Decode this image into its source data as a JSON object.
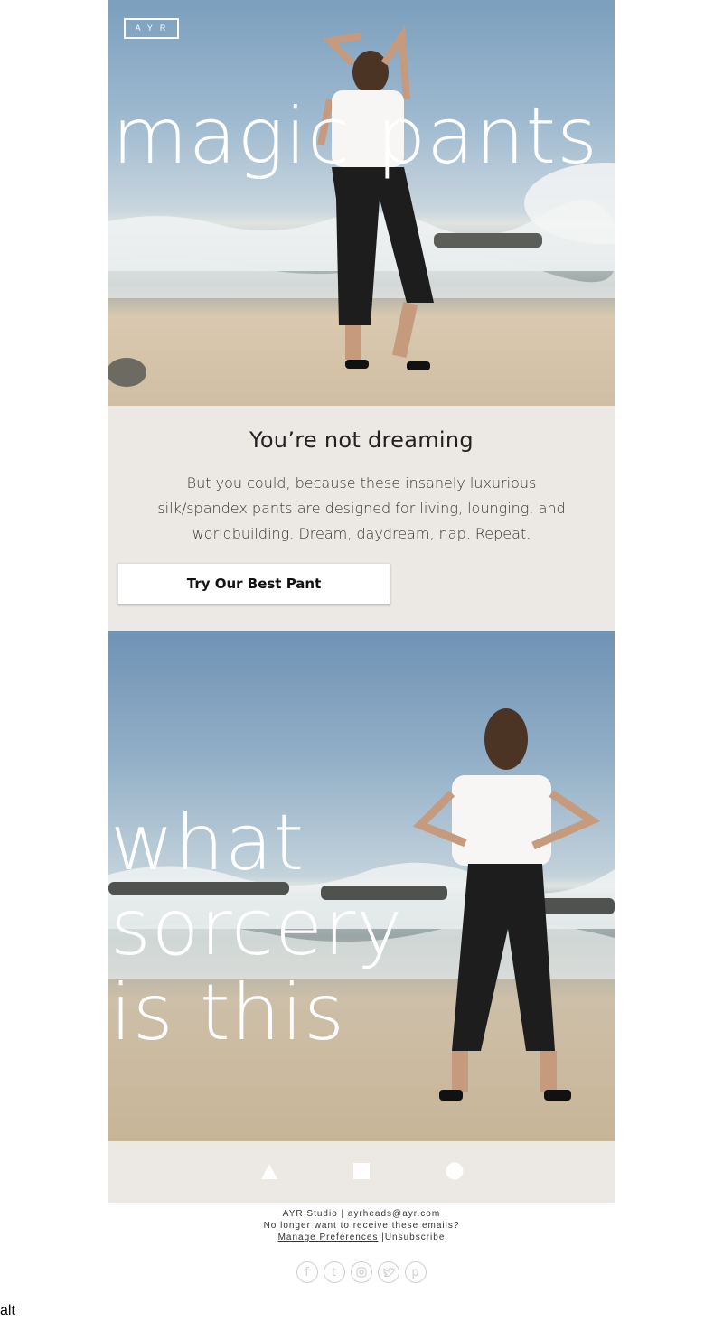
{
  "brand": {
    "logo_text": "AYR"
  },
  "hero1": {
    "headline": "magic pants"
  },
  "copy": {
    "heading": "You’re not dreaming",
    "body": "But you could, because these insanely luxurious silk/spandex pants are designed for living, lounging, and worldbuilding. Dream, daydream, nap. Repeat.",
    "cta_label": "Try Our Best Pant"
  },
  "hero2": {
    "headline_lines": [
      "what",
      "sorcery",
      "is this"
    ]
  },
  "icon_bar": {
    "icons": [
      "triangle-icon",
      "square-icon",
      "circle-icon"
    ]
  },
  "footer": {
    "studio_line": "AYR Studio | ayrheads@ayr.com",
    "optout_line": "No longer want to receive these emails?",
    "manage_label": "Manage Preferences",
    "separator": "|",
    "unsubscribe_label": "Unsubscribe",
    "social_icons": [
      "facebook-icon",
      "tumblr-icon",
      "instagram-icon",
      "twitter-icon",
      "pinterest-icon"
    ]
  },
  "alt_text": "alt",
  "colors": {
    "panel": "#ece9e5",
    "headline": "#ffffff",
    "text": "#222222"
  }
}
